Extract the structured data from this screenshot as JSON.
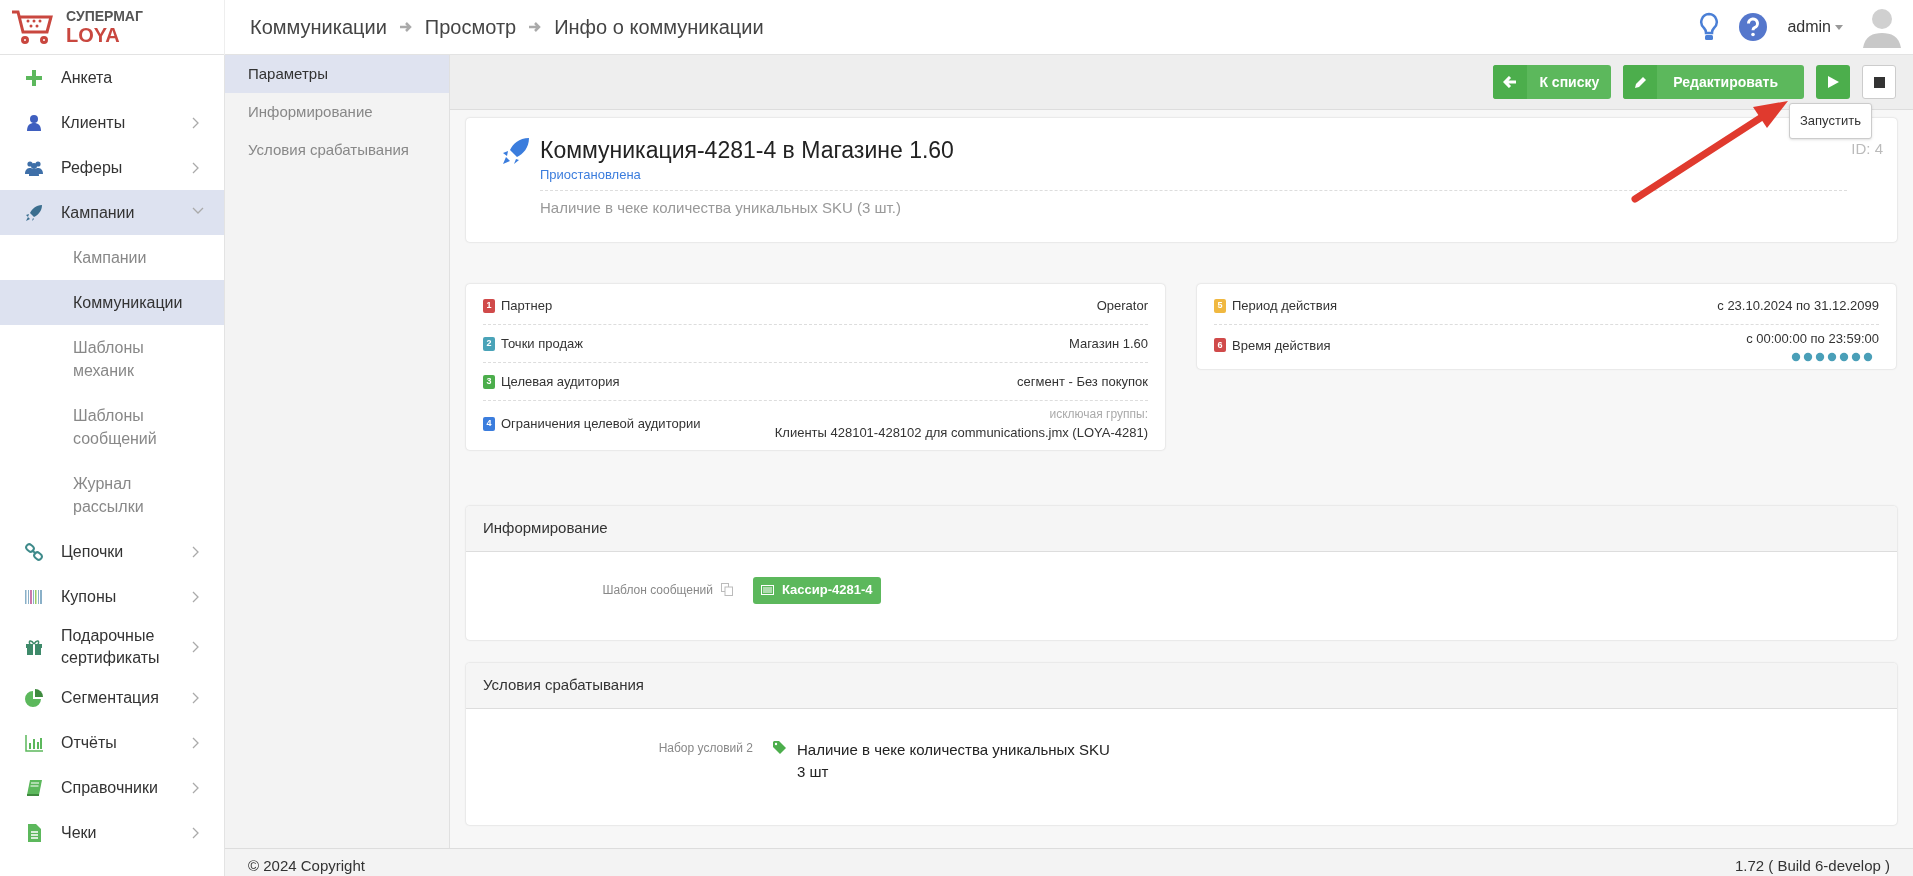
{
  "logo": {
    "top": "СУПЕРМАГ",
    "bottom": "LOYA"
  },
  "breadcrumbs": [
    "Коммуникации",
    "Просмотр",
    "Инфо о коммуникации"
  ],
  "user": {
    "name": "admin"
  },
  "sidebar": {
    "items": [
      {
        "label": "Анкета",
        "kind": "link",
        "selected": false
      },
      {
        "label": "Клиенты",
        "kind": "group",
        "expanded": false,
        "selected": false
      },
      {
        "label": "Реферы",
        "kind": "group",
        "expanded": false,
        "selected": false
      },
      {
        "label": "Кампании",
        "kind": "group",
        "expanded": true,
        "selected": true,
        "children": [
          {
            "label": "Кампании",
            "selected": false
          },
          {
            "label": "Коммуникации",
            "selected": true
          },
          {
            "label": "Шаблоны механик",
            "selected": false
          },
          {
            "label": "Шаблоны сообщений",
            "selected": false
          },
          {
            "label": "Журнал рассылки",
            "selected": false
          }
        ]
      },
      {
        "label": "Цепочки",
        "kind": "group",
        "expanded": false,
        "selected": false
      },
      {
        "label": "Купоны",
        "kind": "group",
        "expanded": false,
        "selected": false
      },
      {
        "label": "Подарочные сертификаты",
        "kind": "group",
        "expanded": false,
        "selected": false
      },
      {
        "label": "Сегментация",
        "kind": "group",
        "expanded": false,
        "selected": false
      },
      {
        "label": "Отчёты",
        "kind": "group",
        "expanded": false,
        "selected": false
      },
      {
        "label": "Справочники",
        "kind": "group",
        "expanded": false,
        "selected": false
      },
      {
        "label": "Чеки",
        "kind": "group",
        "expanded": false,
        "selected": false
      }
    ]
  },
  "section_nav": [
    {
      "label": "Параметры",
      "selected": true
    },
    {
      "label": "Информирование",
      "selected": false
    },
    {
      "label": "Условия срабатывания",
      "selected": false
    }
  ],
  "toolbar": {
    "buttons": [
      {
        "kind": "back",
        "label": "К списку"
      },
      {
        "kind": "edit",
        "label": "Редактировать"
      },
      {
        "kind": "play"
      },
      {
        "kind": "stop"
      }
    ],
    "tooltip": "Запустить"
  },
  "header_card": {
    "title": "Коммуникация-4281-4 в Магазине 1.60",
    "status": "Приостановлена",
    "description": "Наличие в чеке количества уникальных SKU (3 шт.)",
    "id": "ID: 4"
  },
  "params_left": [
    {
      "number": "1",
      "color": "#d04a4a",
      "label": "Партнер",
      "value": "Operator"
    },
    {
      "number": "2",
      "color": "#4aa3b8",
      "label": "Точки продаж",
      "value": "Магазин 1.60"
    },
    {
      "number": "3",
      "color": "#4cae4c",
      "label": "Целевая аудитория",
      "value": "сегмент - Без покупок"
    },
    {
      "number": "4",
      "color": "#3b7ddd",
      "label": "Ограничения целевой аудитории",
      "note": "исключая группы:",
      "value": "Клиенты 428101-428102 для communications.jmx (LOYA-4281)"
    }
  ],
  "params_right": [
    {
      "number": "5",
      "color": "#f0b840",
      "label": "Период действия",
      "value": "с 23.10.2024 по 31.12.2099"
    },
    {
      "number": "6",
      "color": "#d04a4a",
      "label": "Время действия",
      "value": "с 00:00:00 по 23:59:00",
      "weekdays": true
    }
  ],
  "informing": {
    "title": "Информирование",
    "field_label": "Шаблон сообщений",
    "template": "Кассир-4281-4"
  },
  "triggers": {
    "title": "Условия срабатывания",
    "field_label": "Набор условий 2",
    "condition": "Наличие в чеке количества уникальных SKU",
    "detail": "3 шт"
  },
  "footer": {
    "copyright": "© 2024 Copyright",
    "version": "1.72 ( Build 6-develop )"
  }
}
